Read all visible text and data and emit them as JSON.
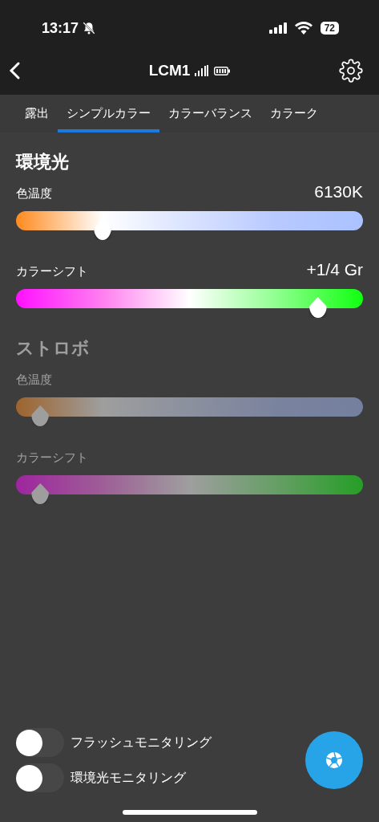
{
  "status_bar": {
    "time": "13:17",
    "battery": "72"
  },
  "nav": {
    "title": "LCM1"
  },
  "tabs": [
    {
      "label": "露出",
      "selected": false
    },
    {
      "label": "シンプルカラー",
      "selected": true
    },
    {
      "label": "カラーバランス",
      "selected": false
    },
    {
      "label": "カラーク",
      "selected": false
    }
  ],
  "sections": [
    {
      "title": "環境光",
      "disabled": false,
      "sliders": [
        {
          "kind": "temperature",
          "label": "色温度",
          "reading": "6130K",
          "level": 0.25
        },
        {
          "kind": "tint",
          "label": "カラーシフト",
          "reading": "+1/4 Gr",
          "level": 0.87
        }
      ]
    },
    {
      "title": "ストロボ",
      "disabled": true,
      "sliders": [
        {
          "kind": "temperature",
          "label": "色温度",
          "level": 0.07
        },
        {
          "kind": "tint",
          "label": "カラーシフト",
          "level": 0.07
        }
      ]
    }
  ],
  "toggles": [
    {
      "label": "フラッシュモニタリング",
      "on": false
    },
    {
      "label": "環境光モニタリング",
      "on": false
    }
  ]
}
